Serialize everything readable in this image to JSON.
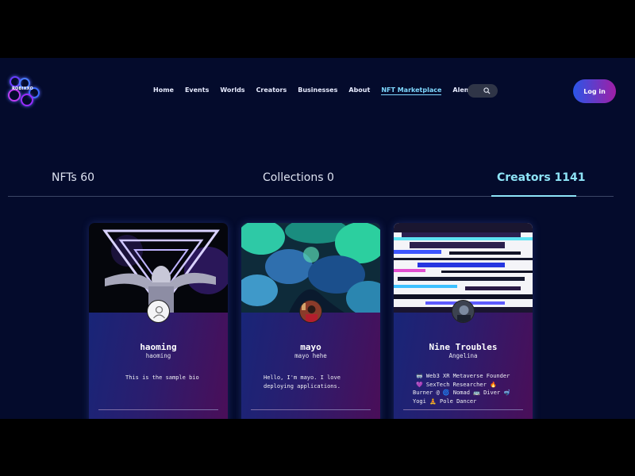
{
  "header": {
    "logo_text": "ROBIXXO",
    "nav": [
      {
        "label": "Home"
      },
      {
        "label": "Events"
      },
      {
        "label": "Worlds"
      },
      {
        "label": "Creators"
      },
      {
        "label": "Businesses"
      },
      {
        "label": "About"
      },
      {
        "label": "NFT Marketplace",
        "active": true
      },
      {
        "label": "Alementals"
      }
    ],
    "search_icon": "search-icon",
    "login_label": "Log in"
  },
  "tabs": [
    {
      "label": "NFTs 60"
    },
    {
      "label": "Collections 0"
    },
    {
      "label": "Creators 1141",
      "active": true
    }
  ],
  "cards": [
    {
      "name": "haoming",
      "username": "haoming",
      "bio": "This is the sample bio",
      "avatar_icon": "default-user-icon"
    },
    {
      "name": "mayo",
      "username": "mayo hehe",
      "bio": "Hello, I'm mayo. I love deploying applications."
    },
    {
      "name": "Nine Troubles",
      "username": "Angelina",
      "bio_lines": [
        "🥽 Web3 XR Metaverse Founder",
        "💜 SexTech Researcher 🔥",
        "Burner @ 🌀 Nomad 🚌 Diver 🤿",
        "Yogi 🧘 Pole Dancer"
      ]
    }
  ],
  "colors": {
    "background": "#040b2c",
    "accent": "#8ee4f7",
    "login_gradient_start": "#2a56e8",
    "login_gradient_end": "#a01ea6"
  }
}
